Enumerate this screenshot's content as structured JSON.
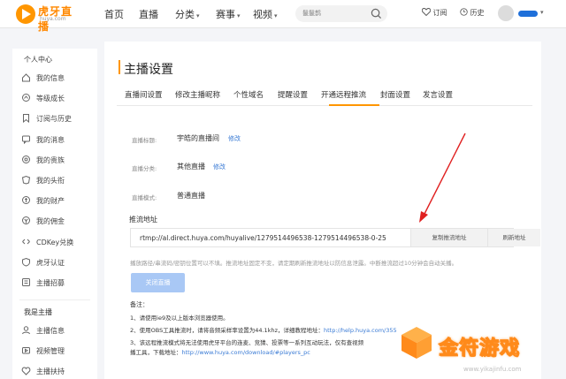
{
  "brand": {
    "name": "虎牙直播",
    "sub": "huya.com",
    "color": "#ff9600"
  },
  "nav": {
    "home": "首页",
    "live": "直播",
    "category": "分类",
    "events": "赛事",
    "video": "视频",
    "search_placeholder": "鬣鬣鹊",
    "subscribe": "订阅",
    "history": "历史"
  },
  "sidebar": {
    "personal_head": "个人中心",
    "personal_items": [
      {
        "label": "我的信息",
        "icon": "home-icon"
      },
      {
        "label": "等级成长",
        "icon": "level-icon"
      },
      {
        "label": "订阅与历史",
        "icon": "bookmark-icon"
      },
      {
        "label": "我的消息",
        "icon": "message-icon"
      },
      {
        "label": "我的贵族",
        "icon": "noble-icon"
      },
      {
        "label": "我的头衔",
        "icon": "title-badge-icon"
      },
      {
        "label": "我的财产",
        "icon": "wallet-icon"
      },
      {
        "label": "我的佣金",
        "icon": "coin-icon"
      },
      {
        "label": "CDKey兑换",
        "icon": "key-icon"
      },
      {
        "label": "虎牙认证",
        "icon": "verify-icon"
      },
      {
        "label": "主播招募",
        "icon": "recruit-icon"
      }
    ],
    "anchor_head": "我是主播",
    "anchor_items": [
      {
        "label": "主播信息",
        "icon": "user-icon"
      },
      {
        "label": "视频管理",
        "icon": "video-icon"
      },
      {
        "label": "主播扶持",
        "icon": "support-icon"
      }
    ]
  },
  "main": {
    "title": "主播设置",
    "tabs": [
      "直播间设置",
      "修改主播昵称",
      "个性域名",
      "提醒设置",
      "开通远程推流",
      "封面设置",
      "发言设置"
    ],
    "active_tab": "开通远程推流",
    "fields": [
      {
        "label": "直播标题:",
        "value": "宇皓的直播间",
        "link": "修改"
      },
      {
        "label": "直播分类:",
        "value": "其他直播",
        "link": "修改"
      },
      {
        "label": "直播模式:",
        "value": "普通直播",
        "link": ""
      }
    ],
    "push_label": "推流地址",
    "push_url": "rtmp://al.direct.huya.com/huyalive/1279514496538-1279514496538-0-25",
    "copy_button": "复制推流地址",
    "refresh_button": "刷新地址",
    "warning": "播放路径/串流码/密钥位置可以不填。推流地址固定不变，请定期刷新推流地址以防信息泄露。中断推流超过10分钟会自动关播。",
    "close_button": "关闭直播",
    "notes_title": "备注：",
    "notes": [
      {
        "text": "1、请使用ie9及以上版本浏览器使用。",
        "link": ""
      },
      {
        "text": "2、使用OBS工具推流时，请将音频采样率设置为44.1khz，详细教程地址：",
        "link": "http://help.huya.com/355"
      },
      {
        "text": "3、该远程推流模式将无法使用虎牙平台的连麦、竞猜、投票等一系列互动玩法，仅有查视频",
        "link": ""
      },
      {
        "text": "播工具，下载地址：",
        "link": "http://www.huya.com/download/#players_pc"
      }
    ]
  },
  "watermark": {
    "text": "金符游戏",
    "url": "www.yikajinfu.com"
  },
  "colors": {
    "accent": "#ff9600",
    "link": "#3a7bd5",
    "arrow": "#e02020"
  }
}
